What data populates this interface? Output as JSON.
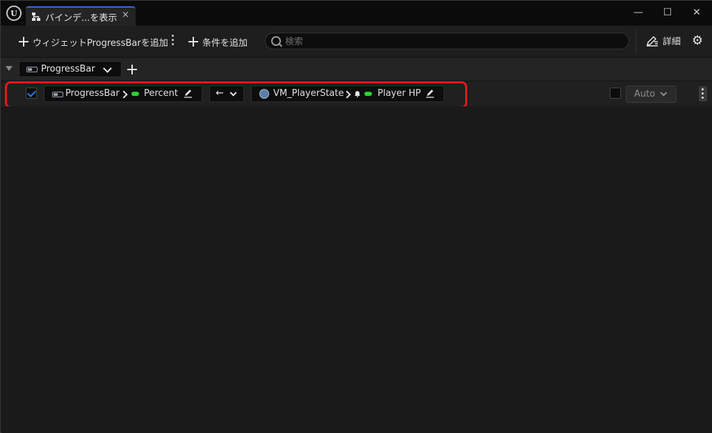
{
  "window": {
    "tab_label": "バインデ...を表示",
    "tab_close": "×",
    "logo_text": "U",
    "minimize": "—",
    "maximize": "☐",
    "close": "✕"
  },
  "toolbar": {
    "add_widget_label": "ウィジェットProgressBarを追加",
    "add_condition_label": "条件を追加",
    "search_placeholder": "検索",
    "details_label": "詳細",
    "settings_icon": "⚙"
  },
  "group": {
    "widget_name": "ProgressBar"
  },
  "binding": {
    "enabled": true,
    "widget_name": "ProgressBar",
    "widget_property": "Percent",
    "direction_arrow": "←",
    "viewmodel_name": "VM_PlayerState",
    "viewmodel_property": "Player HP",
    "execution_mode": "Auto"
  },
  "colors": {
    "accent_blue": "#2f7df6",
    "field_green": "#2bd133",
    "highlight_red": "#e01a1a"
  }
}
